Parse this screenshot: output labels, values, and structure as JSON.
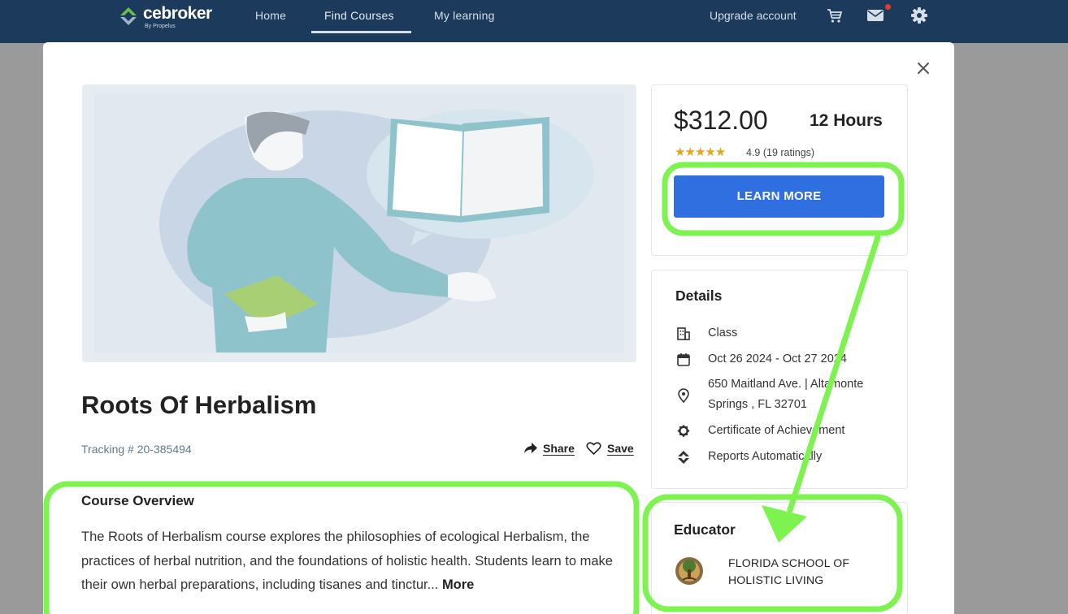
{
  "nav": {
    "logo_text": "cebroker",
    "logo_sub": "By Propelus",
    "links": [
      "Home",
      "Find Courses",
      "My learning"
    ],
    "active_link": "Find Courses",
    "upgrade": "Upgrade account",
    "icons": [
      "cart-icon",
      "mail-icon",
      "gear-icon"
    ]
  },
  "course": {
    "title": "Roots Of Herbalism",
    "tracking": "Tracking # 20-385494",
    "share_label": "Share",
    "save_label": "Save",
    "overview_title": "Course Overview",
    "overview_text": "The Roots of Herbalism course explores the philosophies of ecological Herbalism, the practices of herbal nutrition, and the foundations of holistic health. Students learn to make their own herbal preparations, including tisanes and tinctur... ",
    "more_label": "More"
  },
  "purchase": {
    "price": "$312.00",
    "hours": "12 Hours",
    "stars": "★★★★★",
    "rating_value": 4.9,
    "rating_text": "4.9 (19 ratings)",
    "cta": "LEARN MORE"
  },
  "details": {
    "title": "Details",
    "items": [
      {
        "icon": "building-icon",
        "text": "Class"
      },
      {
        "icon": "calendar-icon",
        "text": "Oct 26 2024 - Oct 27 2024"
      },
      {
        "icon": "location-pin-icon",
        "text_line1": "650 Maitland Ave. | Altamonte",
        "text_line2": "Springs , FL 32701"
      },
      {
        "icon": "certificate-icon",
        "text": "Certificate of Achievement"
      },
      {
        "icon": "reports-icon",
        "text": "Reports Automatically"
      }
    ]
  },
  "educator": {
    "title": "Educator",
    "name_line1": "FLORIDA SCHOOL OF",
    "name_line2": "HOLISTIC LIVING"
  },
  "colors": {
    "nav_bg": "#1b3a5c",
    "cta_bg": "#2f6fe0",
    "annotation": "#7cf34f",
    "star": "#e8a317",
    "notification": "#e53935"
  }
}
